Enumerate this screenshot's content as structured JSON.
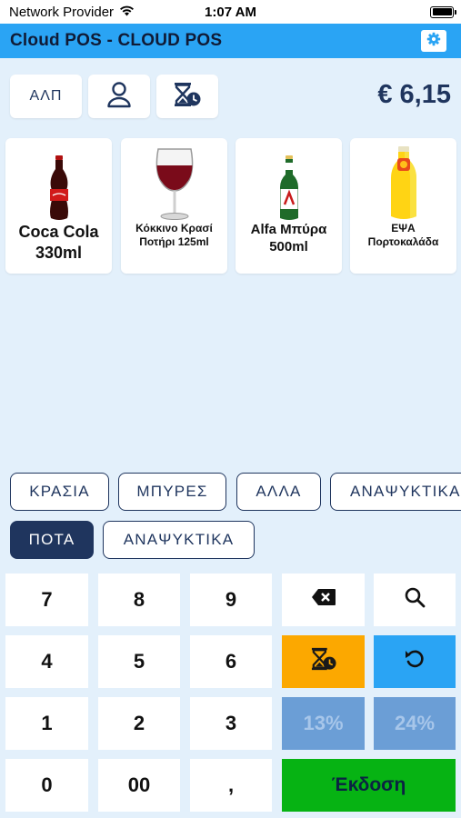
{
  "status_bar": {
    "carrier": "Network Provider",
    "time": "1:07 AM"
  },
  "header": {
    "title": "Cloud POS - CLOUD POS"
  },
  "toolbar": {
    "alp_label": "ΑΛΠ",
    "total": "€ 6,15"
  },
  "products": [
    {
      "name_line1": "Coca Cola",
      "name_line2": "330ml",
      "icon": "cola-bottle-icon"
    },
    {
      "name_line1": "Κόκκινο Κρασί",
      "name_line2": "Ποτήρι 125ml",
      "icon": "wine-glass-icon"
    },
    {
      "name_line1": "Alfa Μπύρα",
      "name_line2": "500ml",
      "icon": "beer-bottle-icon"
    },
    {
      "name_line1": "ΕΨΑ",
      "name_line2": "Πορτοκαλάδα",
      "icon": "orange-soda-bottle-icon"
    }
  ],
  "categories_row1": [
    "ΚΡΑΣΙΑ",
    "ΜΠΥΡΕΣ",
    "ΑΛΛΑ",
    "ΑΝΑΨΥΚΤΙΚΑ"
  ],
  "categories_row2": [
    "ΠΟΤΑ",
    "ΑΝΑΨΥΚΤΙΚΑ"
  ],
  "active_category": "ΠΟΤΑ",
  "keypad": {
    "k7": "7",
    "k8": "8",
    "k9": "9",
    "k4": "4",
    "k5": "5",
    "k6": "6",
    "k1": "1",
    "k2": "2",
    "k3": "3",
    "k0": "0",
    "k00": "00",
    "kcomma": ",",
    "vat13": "13%",
    "vat24": "24%",
    "issue": "Έκδοση"
  },
  "colors": {
    "header_blue": "#2aa4f4",
    "navy": "#1f355e",
    "orange": "#fca800",
    "green": "#06b313",
    "muted_blue": "#6b9ed6",
    "background": "#e3f0fb"
  }
}
